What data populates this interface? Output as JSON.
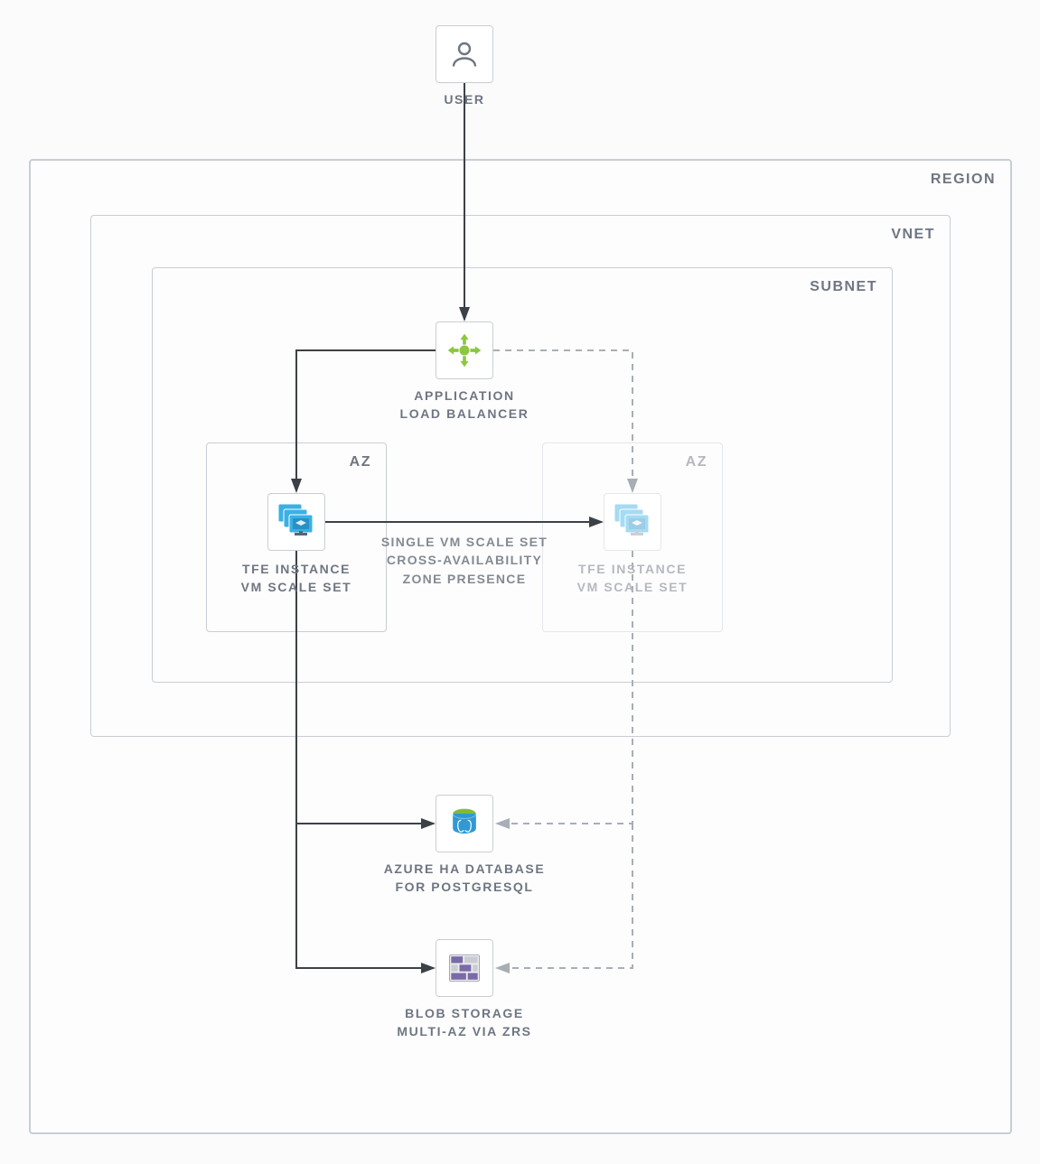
{
  "labels": {
    "user": "USER",
    "region": "REGION",
    "vnet": "VNET",
    "subnet": "SUBNET",
    "lb_l1": "APPLICATION",
    "lb_l2": "LOAD BALANCER",
    "az": "AZ",
    "tfe_l1": "TFE INSTANCE",
    "tfe_l2": "VM SCALE SET",
    "mid_l1": "SINGLE VM SCALE SET",
    "mid_l2": "CROSS-AVAILABILITY",
    "mid_l3": "ZONE PRESENCE",
    "db_l1": "AZURE HA DATABASE",
    "db_l2": "FOR POSTGRESQL",
    "blob_l1": "BLOB STORAGE",
    "blob_l2": "MULTI-AZ VIA ZRS"
  },
  "colors": {
    "lb_green": "#8dc63f",
    "vm_blue": "#3ab0e5",
    "vm_blue_faded": "#a9d9ef",
    "pg_blue": "#2f99d4",
    "blob_purple": "#7b6aa8"
  },
  "diagram": {
    "title": "TFE on Azure architecture",
    "nodes": [
      "user",
      "application-load-balancer",
      "tfe-instance-az1",
      "tfe-instance-az2",
      "azure-ha-postgresql",
      "blob-storage-zrs"
    ],
    "zones": [
      "region",
      "vnet",
      "subnet",
      "az1",
      "az2"
    ],
    "edges": [
      {
        "from": "user",
        "to": "application-load-balancer",
        "style": "solid"
      },
      {
        "from": "application-load-balancer",
        "to": "tfe-instance-az1",
        "style": "solid"
      },
      {
        "from": "application-load-balancer",
        "to": "tfe-instance-az2",
        "style": "dashed"
      },
      {
        "from": "tfe-instance-az1",
        "to": "tfe-instance-az2",
        "style": "solid",
        "label": "single-vm-scale-set-cross-az"
      },
      {
        "from": "tfe-instance-az1",
        "to": "azure-ha-postgresql",
        "style": "solid"
      },
      {
        "from": "tfe-instance-az2",
        "to": "azure-ha-postgresql",
        "style": "dashed"
      },
      {
        "from": "tfe-instance-az1",
        "to": "blob-storage-zrs",
        "style": "solid"
      },
      {
        "from": "tfe-instance-az2",
        "to": "blob-storage-zrs",
        "style": "dashed"
      }
    ]
  }
}
